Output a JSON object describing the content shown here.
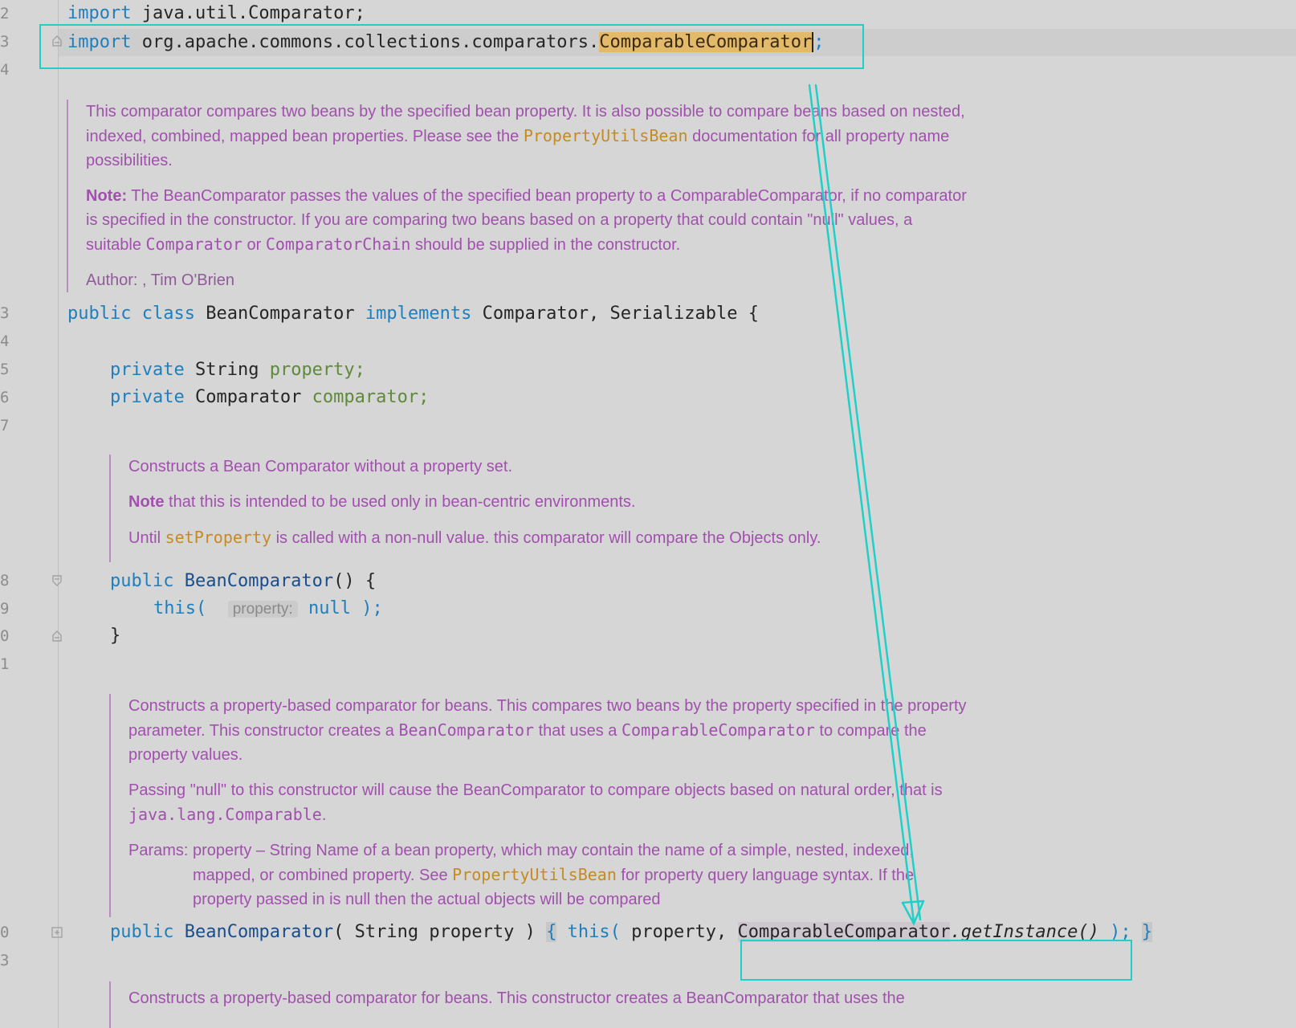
{
  "gutter_numbers": [
    "2",
    "3",
    "4",
    "3",
    "4",
    "5",
    "6",
    "7",
    "8",
    "9",
    "0",
    "1",
    "0",
    "3"
  ],
  "code": {
    "line_import1": {
      "kw": "import",
      "rest": "java.util.Comparator;"
    },
    "line_import2": {
      "kw": "import",
      "pkg": "org.apache.commons.collections.comparators.",
      "cls": "ComparableComparator",
      "semi": ";"
    },
    "class_decl": {
      "kw1": "public",
      "kw2": "class",
      "name": "BeanComparator",
      "kw3": "implements",
      "ifaces": "Comparator, Serializable {",
      "sep": ","
    },
    "field1": {
      "kw": "private",
      "type": "String",
      "name": "property;"
    },
    "field2": {
      "kw": "private",
      "type": "Comparator",
      "name": "comparator;"
    },
    "ctor1": {
      "kw": "public",
      "name": "BeanComparator",
      "rest": "() {"
    },
    "this_call": {
      "kw": "this(",
      "hint": "property:",
      "val": "null",
      "end": ");"
    },
    "close_brace": "}",
    "ctor2": {
      "kw": "public",
      "name": "BeanComparator",
      "params": "( String property )",
      "lbrace": "{",
      "this": "this(",
      "arg": "property,",
      "ref_cls": "ComparableComparator",
      "method": ".getInstance()",
      "end": ");",
      "rbrace": "}"
    }
  },
  "doc1": {
    "p1_a": "This comparator compares two beans by the specified bean property. It is also possible to compare beans based on nested, indexed, combined, mapped bean properties. Please see the ",
    "p1_link": "PropertyUtilsBean",
    "p1_b": " documentation for all property name possibilities.",
    "p2_bold": "Note:",
    "p2_a": " The BeanComparator passes the values of the specified bean property to a ComparableComparator, if no comparator is specified in the constructor. If you are comparing two beans based on a property that could contain \"null\" values, a suitable ",
    "p2_code1": "Comparator",
    "p2_or": " or ",
    "p2_code2": "ComparatorChain",
    "p2_b": " should be supplied in the constructor.",
    "author": "Author: , Tim O'Brien"
  },
  "doc2": {
    "p1": "Constructs a Bean Comparator without a property set.",
    "p2_bold": "Note",
    "p2": " that this is intended to be used only in bean-centric environments.",
    "p3_a": "Until ",
    "p3_link": "setProperty",
    "p3_b": " is called with a non-null value. this comparator will compare the Objects only."
  },
  "doc3": {
    "p1_a": "Constructs a property-based comparator for beans. This compares two beans by the property specified in the property parameter. This constructor creates a ",
    "p1_code1": "BeanComparator",
    "p1_b": " that uses a ",
    "p1_code2": "ComparableComparator",
    "p1_c": " to compare the property values.",
    "p2_a": "Passing \"null\" to this constructor will cause the BeanComparator to compare objects based on natural order, that is ",
    "p2_code": "java.lang.Comparable",
    "p2_b": ".",
    "params_label": "Params:",
    "params_a": "property – String Name of a bean property, which may contain the name of a simple, nested, indexed, mapped, or combined property. See ",
    "params_link": "PropertyUtilsBean",
    "params_b": " for property query language syntax. If the property passed in is null then the actual objects will be compared"
  },
  "doc4": {
    "p1": "Constructs a property-based comparator for beans. This constructor creates a BeanComparator that uses the"
  },
  "colors": {
    "annotation": "#1fd0c8",
    "doc_text": "#a150ad",
    "selection": "#e3b96a"
  }
}
